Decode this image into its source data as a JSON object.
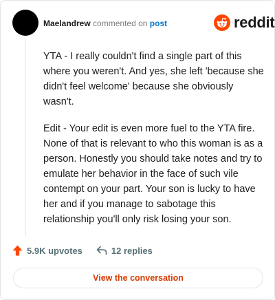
{
  "comment": {
    "username": "Maelandrew",
    "action_text": "commented on",
    "post_link": "post",
    "paragraphs": [
      "YTA - I really couldn't find a single part of this where you weren't. And yes, she left 'because she didn't feel welcome' because she obviously wasn't.",
      "Edit - Your edit is even more fuel to the YTA fire. None of that is relevant to who this woman is as a person. Honestly you should take notes and try to emulate her behavior in the face of such vile contempt on your part. Your son is lucky to have her and if you manage to sabotage this relationship you'll only risk losing your son."
    ]
  },
  "brand": {
    "name": "reddit",
    "logo_icon": "reddit-snoo-icon",
    "color": "#ff4500"
  },
  "stats": {
    "upvotes": "5.9K upvotes",
    "replies": "12 replies",
    "upvote_icon": "upvote-arrow-icon",
    "reply_icon": "reply-arrow-icon",
    "upvote_color": "#ff4500"
  },
  "cta": {
    "label": "View the conversation",
    "color": "#d93a00"
  }
}
